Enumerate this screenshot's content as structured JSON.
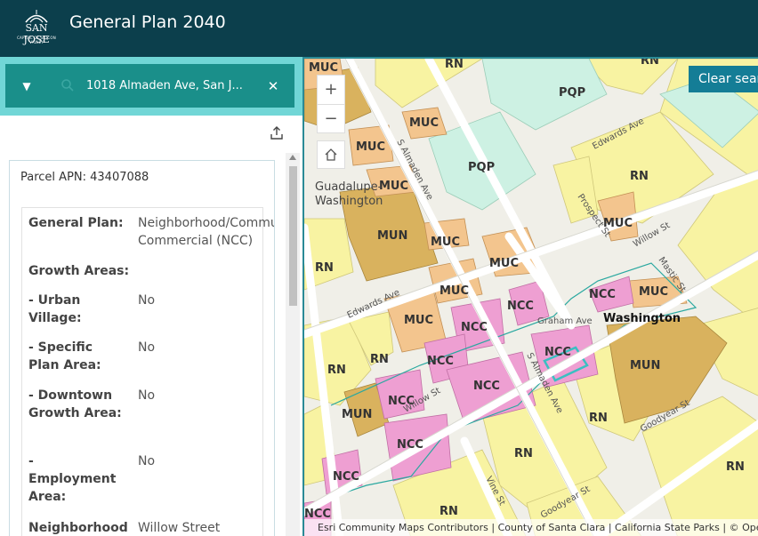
{
  "header": {
    "title": "General Plan 2040",
    "logo_text": "SAN JOSE",
    "logo_subtext": "CAPITAL OF SILICON VALLEY"
  },
  "search": {
    "value": "1018 Almaden Ave, San J...",
    "caret_icon": "chevron-down-icon",
    "search_icon": "search-icon",
    "clear_icon": "close-icon"
  },
  "panel": {
    "share_icon": "share-icon",
    "apn": "Parcel APN: 43407088",
    "rows": [
      {
        "key": "General Plan:",
        "value": "Neighborhood/Community Commercial (NCC)"
      },
      {
        "key": "Growth Areas:",
        "value": ""
      },
      {
        "key": "- Urban Village:",
        "value": "No"
      },
      {
        "key": "- Specific Plan Area:",
        "value": "No"
      },
      {
        "key": "- Downtown Growth Area:",
        "value": "No"
      },
      {
        "key": "- Employment Area:",
        "value": "No"
      },
      {
        "key": "Neighborhood",
        "value": "Willow Street"
      }
    ]
  },
  "map": {
    "clear_button": "Clear search",
    "zoom_in": "+",
    "zoom_out": "−",
    "home_icon": "home-icon",
    "attribution": "Esri Community Maps Contributors | County of Santa Clara | California State Parks | © OpenStreetMap",
    "colors": {
      "RN": "#f8f3a2",
      "MUC": "#f3c58e",
      "MUN": "#d9b25e",
      "NCC": "#ee9fd2",
      "PQP": "#cdf1e3",
      "highlight": "#3bbfc2"
    },
    "place_labels": [
      "Guadalupe-Washington",
      "Washington"
    ],
    "street_labels": [
      "S Almaden Ave",
      "Edwards Ave",
      "Prospect St",
      "Willow St",
      "Graham Ave",
      "Goodyear St",
      "Vine St",
      "Mastic St"
    ],
    "zone_labels": [
      "RN",
      "MUC",
      "MUN",
      "NCC",
      "PQP"
    ]
  }
}
